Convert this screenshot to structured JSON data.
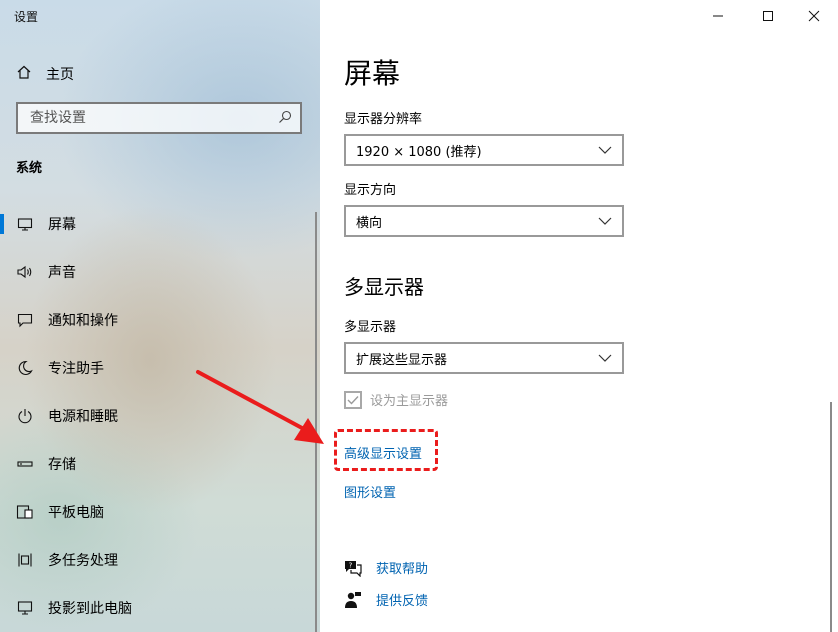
{
  "window": {
    "title": "设置"
  },
  "sidebar": {
    "home_label": "主页",
    "search_placeholder": "查找设置",
    "section_title": "系统",
    "items": [
      {
        "label": "屏幕",
        "icon": "monitor-icon"
      },
      {
        "label": "声音",
        "icon": "speaker-icon"
      },
      {
        "label": "通知和操作",
        "icon": "notification-icon"
      },
      {
        "label": "专注助手",
        "icon": "moon-icon"
      },
      {
        "label": "电源和睡眠",
        "icon": "power-icon"
      },
      {
        "label": "存储",
        "icon": "storage-icon"
      },
      {
        "label": "平板电脑",
        "icon": "tablet-icon"
      },
      {
        "label": "多任务处理",
        "icon": "multitask-icon"
      },
      {
        "label": "投影到此电脑",
        "icon": "project-icon"
      }
    ],
    "active_index": 0
  },
  "main": {
    "title": "屏幕",
    "resolution_label": "显示器分辨率",
    "resolution_value": "1920 × 1080 (推荐)",
    "orientation_label": "显示方向",
    "orientation_value": "横向",
    "multi_title": "多显示器",
    "multi_label": "多显示器",
    "multi_value": "扩展这些显示器",
    "make_main_label": "设为主显示器",
    "make_main_checked": true,
    "make_main_disabled": true,
    "advanced_link": "高级显示设置",
    "graphics_link": "图形设置",
    "get_help": "获取帮助",
    "give_feedback": "提供反馈"
  },
  "colors": {
    "accent": "#0078d7",
    "link": "#0063b1",
    "annotation": "#ea1c1c"
  }
}
